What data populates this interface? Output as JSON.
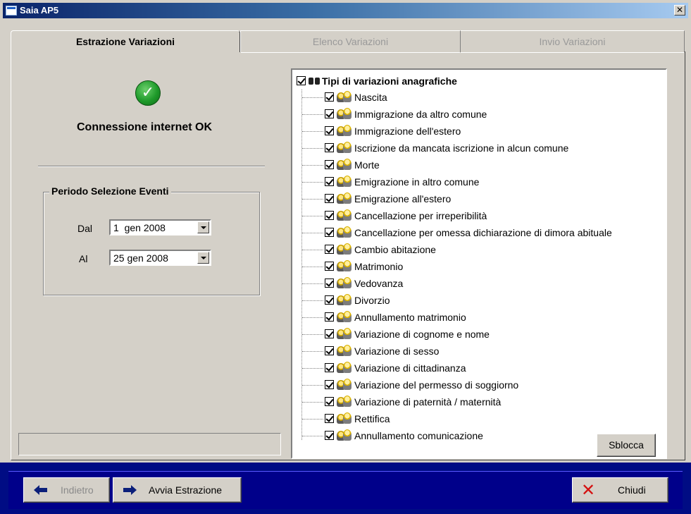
{
  "window": {
    "title": "Saia AP5",
    "close_glyph": "✕"
  },
  "tabs": [
    {
      "label": "Estrazione Variazioni",
      "active": true
    },
    {
      "label": "Elenco Variazioni",
      "active": false
    },
    {
      "label": "Invio Variazioni",
      "active": false
    }
  ],
  "status": {
    "icon": "check-circle-icon",
    "text": "Connessione internet OK",
    "check_glyph": "✓"
  },
  "period": {
    "title": "Periodo Selezione Eventi",
    "from_label": "Dal",
    "from_value": "1  gen 2008",
    "to_label": "Al",
    "to_value": "25 gen 2008"
  },
  "tree": {
    "root_label": "Tipi di variazioni anagrafiche",
    "items": [
      "Nascita",
      "Immigrazione da altro comune",
      "Immigrazione dell'estero",
      "Iscrizione da mancata iscrizione in alcun comune",
      "Morte",
      "Emigrazione in altro comune",
      "Emigrazione all'estero",
      "Cancellazione per irreperibilità",
      "Cancellazione per omessa dichiarazione di dimora abituale",
      "Cambio abitazione",
      "Matrimonio",
      "Vedovanza",
      "Divorzio",
      "Annullamento matrimonio",
      "Variazione di cognome e nome",
      "Variazione di sesso",
      "Variazione di cittadinanza",
      "Variazione del permesso di soggiorno",
      "Variazione di paternità / maternità",
      "Rettifica",
      "Annullamento comunicazione"
    ]
  },
  "buttons": {
    "unlock": "Sblocca",
    "back": "Indietro",
    "start": "Avvia Estrazione",
    "close": "Chiudi",
    "close_glyph": "✕"
  },
  "colors": {
    "titlebar": "#0a246a",
    "bottom_bar": "#000c84",
    "window_bg": "#d4d0c8",
    "check_green": "#1e9a2a"
  }
}
